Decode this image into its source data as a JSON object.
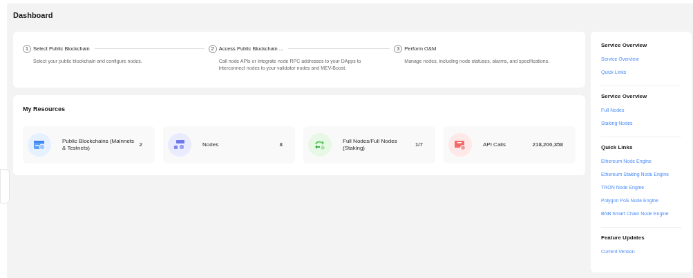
{
  "page_title": "Dashboard",
  "steps": [
    {
      "number": "1",
      "title": "Select Public Blockchain",
      "description": "Select your public blockchain and configure nodes."
    },
    {
      "number": "2",
      "title": "Access Public Blockchain ...",
      "description": "Call node APIs or integrate node RPC addresses to your DApps to interconnect nodes to your validator nodes and MEV-Boost."
    },
    {
      "number": "3",
      "title": "Perform O&M",
      "description": "Manage nodes, including node statuses, alarms, and specifications."
    }
  ],
  "resources": {
    "title": "My Resources",
    "items": [
      {
        "kind": "chain",
        "label": "Public Blockchains (Mainnets & Testnets)",
        "value": "2"
      },
      {
        "kind": "nodes",
        "label": "Nodes",
        "value": "8"
      },
      {
        "kind": "fullnodes",
        "label": "Full Nodes/Full Nodes (Staking)",
        "value": "1/7"
      },
      {
        "kind": "api",
        "label": "API Calls",
        "value": "218,200,358"
      }
    ]
  },
  "sidebar": {
    "sections": [
      {
        "title": "Service Overview",
        "links": [
          "Service Overview",
          "Quick Links"
        ]
      },
      {
        "title": "Service Overview",
        "links": [
          "Full Nodes",
          "Staking Nodes"
        ]
      },
      {
        "title": "Quick Links",
        "links": [
          "Ethereum Node Engine",
          "Ethereum Staking Node Engine",
          "TRON Node Engine",
          "Polygon PoS Node Engine",
          "BNB Smart Chain Node Engine"
        ]
      },
      {
        "title": "Feature Updates",
        "links": [
          "Current Version"
        ]
      }
    ]
  }
}
